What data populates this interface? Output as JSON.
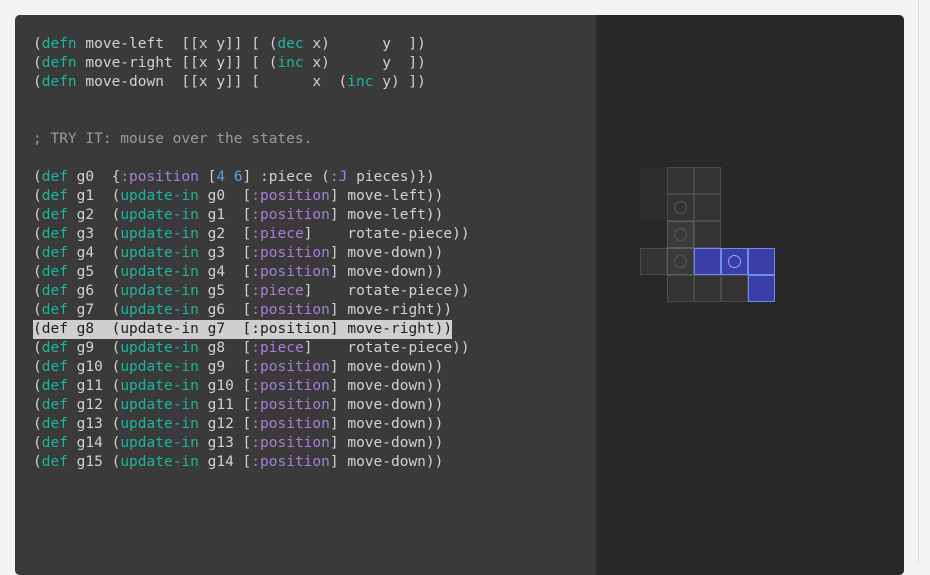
{
  "code": {
    "defns": [
      {
        "head": "(defn move-left  [[x y]] [ (",
        "fn": "dec",
        "tail": " x)      y  ])"
      },
      {
        "head": "(defn move-right [[x y]] [ (",
        "fn": "inc",
        "tail": " x)      y  ])"
      },
      {
        "head": "(defn move-down  [[x y]] [      x  (",
        "fn": "inc",
        "tail": " y) ])"
      }
    ],
    "comment": "; TRY IT: mouse over the states.",
    "g0": {
      "name": "g0  ",
      "key1": ":position",
      "nums": [
        "4",
        "6"
      ],
      "key2": ":piece",
      "key3": ":J",
      "tail": " pieces)})"
    },
    "states": [
      {
        "name": "g1 ",
        "prev": "g0 ",
        "key": ":position",
        "fn": "move-left))"
      },
      {
        "name": "g2 ",
        "prev": "g1 ",
        "key": ":position",
        "fn": "move-left))"
      },
      {
        "name": "g3 ",
        "prev": "g2 ",
        "key": ":piece",
        "fn": "rotate-piece))"
      },
      {
        "name": "g4 ",
        "prev": "g3 ",
        "key": ":position",
        "fn": "move-down))"
      },
      {
        "name": "g5 ",
        "prev": "g4 ",
        "key": ":position",
        "fn": "move-down))"
      },
      {
        "name": "g6 ",
        "prev": "g5 ",
        "key": ":piece",
        "fn": "rotate-piece))"
      },
      {
        "name": "g7 ",
        "prev": "g6 ",
        "key": ":position",
        "fn": "move-right))"
      },
      {
        "name": "g8 ",
        "prev": "g7 ",
        "key": ":position",
        "fn": "move-right))",
        "highlighted": true
      },
      {
        "name": "g9 ",
        "prev": "g8 ",
        "key": ":piece",
        "fn": "rotate-piece))"
      },
      {
        "name": "g10",
        "prev": "g9 ",
        "key": ":position",
        "fn": "move-down))"
      },
      {
        "name": "g11",
        "prev": "g10",
        "key": ":position",
        "fn": "move-down))"
      },
      {
        "name": "g12",
        "prev": "g11",
        "key": ":position",
        "fn": "move-down))"
      },
      {
        "name": "g13",
        "prev": "g12",
        "key": ":position",
        "fn": "move-down))"
      },
      {
        "name": "g14",
        "prev": "g13",
        "key": ":position",
        "fn": "move-down))"
      },
      {
        "name": "g15",
        "prev": "g14",
        "key": ":position",
        "fn": "move-down))"
      }
    ]
  },
  "board": {
    "cells": [
      {
        "col": 0,
        "row": 0,
        "kind": "faint"
      },
      {
        "col": 1,
        "row": 0,
        "kind": "grid"
      },
      {
        "col": 2,
        "row": 0,
        "kind": "grid"
      },
      {
        "col": 0,
        "row": 1,
        "kind": "faint"
      },
      {
        "col": 1,
        "row": 1,
        "kind": "grid",
        "ring": true
      },
      {
        "col": 2,
        "row": 1,
        "kind": "grid"
      },
      {
        "col": 1,
        "row": 2,
        "kind": "ghost",
        "ring": true
      },
      {
        "col": 2,
        "row": 2,
        "kind": "grid"
      },
      {
        "col": 0,
        "row": 3,
        "kind": "grid"
      },
      {
        "col": 1,
        "row": 3,
        "kind": "ghost",
        "ring": true
      },
      {
        "col": 2,
        "row": 3,
        "kind": "piece"
      },
      {
        "col": 3,
        "row": 3,
        "kind": "piece",
        "ring": true
      },
      {
        "col": 4,
        "row": 3,
        "kind": "piece"
      },
      {
        "col": 1,
        "row": 4,
        "kind": "grid"
      },
      {
        "col": 2,
        "row": 4,
        "kind": "grid"
      },
      {
        "col": 3,
        "row": 4,
        "kind": "grid"
      },
      {
        "col": 4,
        "row": 4,
        "kind": "piece"
      }
    ]
  },
  "colors": {
    "keyword": "#19b79c",
    "keyword_arg": "#a57fd6",
    "number": "#5f9ee0",
    "piece_fill": "#3b3ea6",
    "piece_border": "#6a8fe8",
    "highlight": "#cfcfcf"
  }
}
